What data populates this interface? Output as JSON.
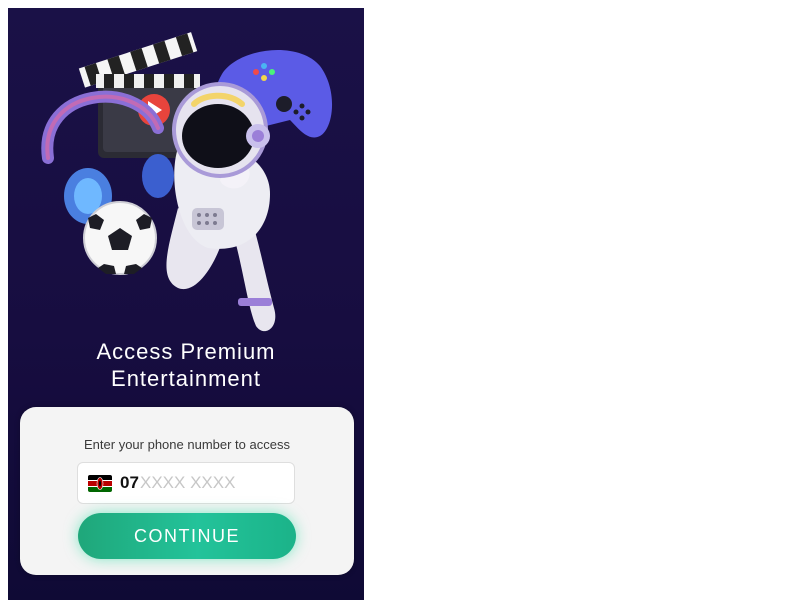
{
  "hero": {
    "illustration": "astronaut-entertainment-illustration",
    "elements": [
      "clapperboard-icon",
      "play-icon",
      "headphones-icon",
      "game-controller-icon",
      "soccer-ball-icon",
      "astronaut"
    ]
  },
  "headline": {
    "line1": "Access Premium",
    "line2": "Entertainment"
  },
  "form": {
    "label": "Enter your phone number to access",
    "country_flag": "kenya-flag-icon",
    "prefix": "07",
    "placeholder": "XXXX XXXX",
    "value": "",
    "button_label": "CONTINUE"
  },
  "colors": {
    "panel_background": "#1a1147",
    "button_green": "#23c39a",
    "card_background": "#f4f4f4"
  }
}
